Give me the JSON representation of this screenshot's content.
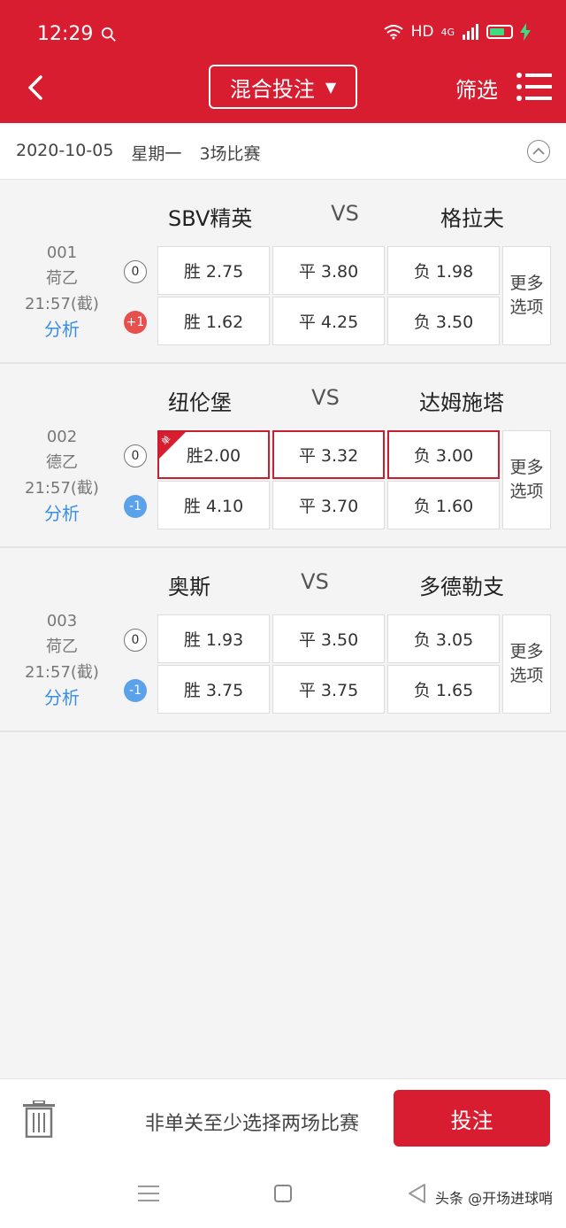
{
  "status": {
    "time": "12:29",
    "network": "HD",
    "signal": "4G"
  },
  "header": {
    "mode_label": "混合投注",
    "mode_caret": "▼",
    "filter_label": "筛选"
  },
  "date_row": {
    "date": "2020-10-05",
    "weekday": "星期一",
    "count": "3场比赛"
  },
  "matches": [
    {
      "home": "SBV精英",
      "vs": "VS",
      "away": "格拉夫",
      "no": "001",
      "league": "荷乙",
      "deadline": "21:57(截)",
      "analysis": "分析",
      "rows": [
        {
          "handicap": "0",
          "win": "胜 2.75",
          "draw": "平 3.80",
          "lose": "负 1.98"
        },
        {
          "handicap": "+1",
          "win": "胜 1.62",
          "draw": "平 4.25",
          "lose": "负 3.50"
        }
      ],
      "more_1": "更多",
      "more_2": "选项"
    },
    {
      "home": "纽伦堡",
      "vs": "VS",
      "away": "达姆施塔",
      "no": "002",
      "league": "德乙",
      "deadline": "21:57(截)",
      "analysis": "分析",
      "rows": [
        {
          "handicap": "0",
          "win": "胜2.00",
          "draw": "平 3.32",
          "lose": "负 3.00",
          "badge": "单"
        },
        {
          "handicap": "-1",
          "win": "胜 4.10",
          "draw": "平 3.70",
          "lose": "负 1.60"
        }
      ],
      "more_1": "更多",
      "more_2": "选项"
    },
    {
      "home": "奥斯",
      "vs": "VS",
      "away": "多德勒支",
      "no": "003",
      "league": "荷乙",
      "deadline": "21:57(截)",
      "analysis": "分析",
      "rows": [
        {
          "handicap": "0",
          "win": "胜 1.93",
          "draw": "平 3.50",
          "lose": "负 3.05"
        },
        {
          "handicap": "-1",
          "win": "胜 3.75",
          "draw": "平 3.75",
          "lose": "负 1.65"
        }
      ],
      "more_1": "更多",
      "more_2": "选项"
    }
  ],
  "action_bar": {
    "hint": "非单关至少选择两场比赛",
    "bet_label": "投注"
  },
  "watermark": "头条 @开场进球哨",
  "colors": {
    "brand_red": "#d81d30",
    "link_blue": "#3a8ee6",
    "handicap_plus": "#e8504d",
    "handicap_minus": "#5ba2e8"
  }
}
